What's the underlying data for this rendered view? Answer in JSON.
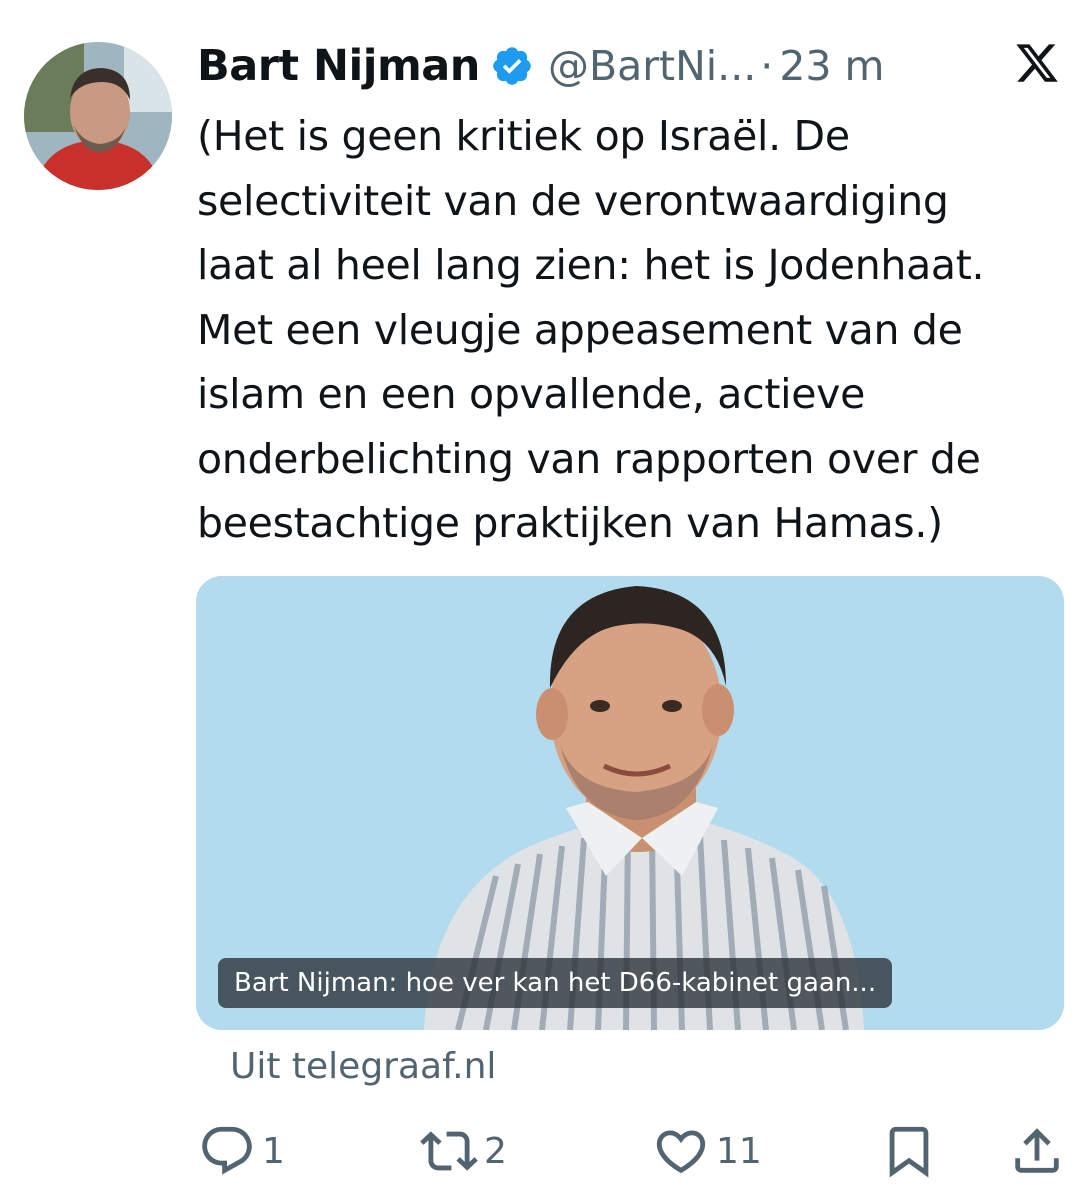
{
  "tweet": {
    "author_name": "Bart Nijman",
    "verified": true,
    "handle": "@BartNi...",
    "separator": "·",
    "time": "23 m",
    "text_lines": [
      "(Het is geen kritiek op Israël. De",
      "selectiviteit van de verontwaardiging",
      "laat al heel lang zien: het is Jodenhaat.",
      "Met een vleugje appeasement van de",
      "islam en een opvallende, actieve",
      "onderbelichting van rapporten over de",
      "beestachtige praktijken van Hamas.)"
    ]
  },
  "link_card": {
    "caption": "Bart Nijman: hoe ver kan het D66-kabinet gaan...",
    "source": "Uit telegraaf.nl",
    "background_color": "#b3dbee"
  },
  "actions": {
    "reply": {
      "icon": "reply-icon",
      "count": "1"
    },
    "retweet": {
      "icon": "retweet-icon",
      "count": "2"
    },
    "like": {
      "icon": "heart-icon",
      "count": "11"
    },
    "bookmark": {
      "icon": "bookmark-icon"
    },
    "share": {
      "icon": "share-icon"
    }
  },
  "colors": {
    "text": "#0f1419",
    "secondary": "#536471",
    "verified_blue": "#1d9bf0"
  }
}
